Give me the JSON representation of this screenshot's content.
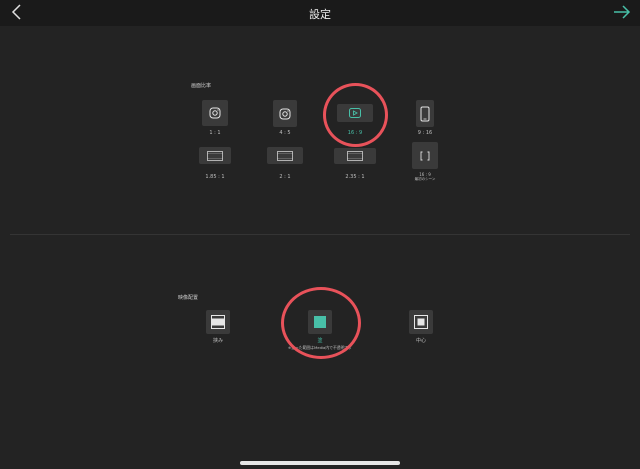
{
  "header": {
    "title": "設定"
  },
  "aspect_section": {
    "label": "画面比率",
    "options": [
      {
        "label": "1 : 1",
        "icon": "instagram-icon"
      },
      {
        "label": "4 : 5",
        "icon": "instagram-icon"
      },
      {
        "label": "16 : 9",
        "icon": "play-icon",
        "selected": true
      },
      {
        "label": "9 : 16",
        "icon": "phone-icon"
      },
      {
        "label": "1.85 : 1",
        "icon": "film-icon"
      },
      {
        "label": "2 : 1",
        "icon": "film-icon"
      },
      {
        "label": "2.35 : 1",
        "icon": "film-icon"
      },
      {
        "label": "16 : 9",
        "sublabel": "最初のシーン",
        "icon": "brackets-icon"
      }
    ]
  },
  "placement_section": {
    "label": "映像配置",
    "options": [
      {
        "label": "挟み",
        "icon": "fit-icon"
      },
      {
        "label": "塗",
        "sublabel": "※塗った範囲はMedia内で不透明です",
        "icon": "fill-icon",
        "selected": true
      },
      {
        "label": "中心",
        "icon": "center-icon"
      }
    ]
  },
  "colors": {
    "accent": "#48c0a8",
    "highlight_ring": "#e8525a",
    "background": "#232323"
  }
}
